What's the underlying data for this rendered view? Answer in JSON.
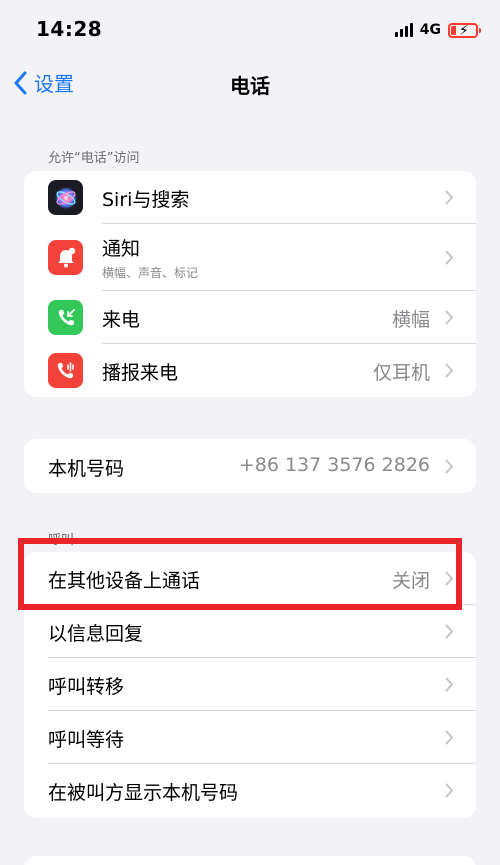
{
  "status": {
    "time": "14:28",
    "network": "4G",
    "icons": [
      "signal-icon",
      "battery-charging-icon"
    ]
  },
  "nav": {
    "back_label": "设置",
    "title": "电话",
    "back_icon": "chevron-left-icon"
  },
  "sections": {
    "allow_access": {
      "header": "允许“电话”访问",
      "items": [
        {
          "label": "Siri与搜索",
          "icon": "siri-icon"
        },
        {
          "label": "通知",
          "sublabel": "横幅、声音、标记",
          "icon": "notification-bell-icon"
        },
        {
          "label": "来电",
          "value": "横幅",
          "icon": "incoming-call-icon"
        },
        {
          "label": "播报来电",
          "value": "仅耳机",
          "icon": "announce-call-icon"
        }
      ]
    },
    "my_number": {
      "items": [
        {
          "label": "本机号码",
          "value": "+86 137 3576 2826"
        }
      ]
    },
    "calls": {
      "header": "呼叫",
      "items": [
        {
          "label": "在其他设备上通话",
          "value": "关闭"
        },
        {
          "label": "以信息回复"
        },
        {
          "label": "呼叫转移"
        },
        {
          "label": "呼叫等待"
        },
        {
          "label": "在被叫方显示本机号码"
        }
      ]
    }
  },
  "colors": {
    "accent": "#1a78f2",
    "background": "#f2f2f7",
    "highlight": "#e8262a"
  }
}
